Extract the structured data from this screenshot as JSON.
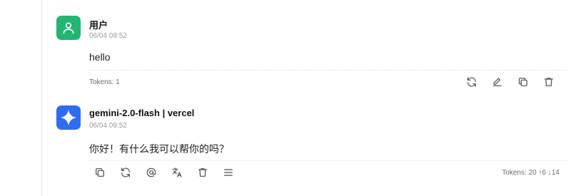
{
  "messages": [
    {
      "role": "user",
      "avatar_icon": "user-icon",
      "avatar_color": "#22b573",
      "name": "用户",
      "time": "06/04 09:52",
      "content": "hello",
      "tokens": "Tokens: 1",
      "actions": [
        "refresh-icon",
        "edit-icon",
        "copy-icon",
        "delete-icon"
      ]
    },
    {
      "role": "assistant",
      "avatar_icon": "gemini-sparkle-icon",
      "avatar_color": "#2f6df0",
      "name": "gemini-2.0-flash | vercel",
      "time": "06/04 09:52",
      "content": "你好！有什么我可以帮你的吗？",
      "tokens": "Tokens: 20 ↑6 ↓14",
      "actions": [
        "copy-icon",
        "refresh-icon",
        "mention-icon",
        "translate-icon",
        "delete-icon",
        "menu-icon"
      ]
    }
  ]
}
